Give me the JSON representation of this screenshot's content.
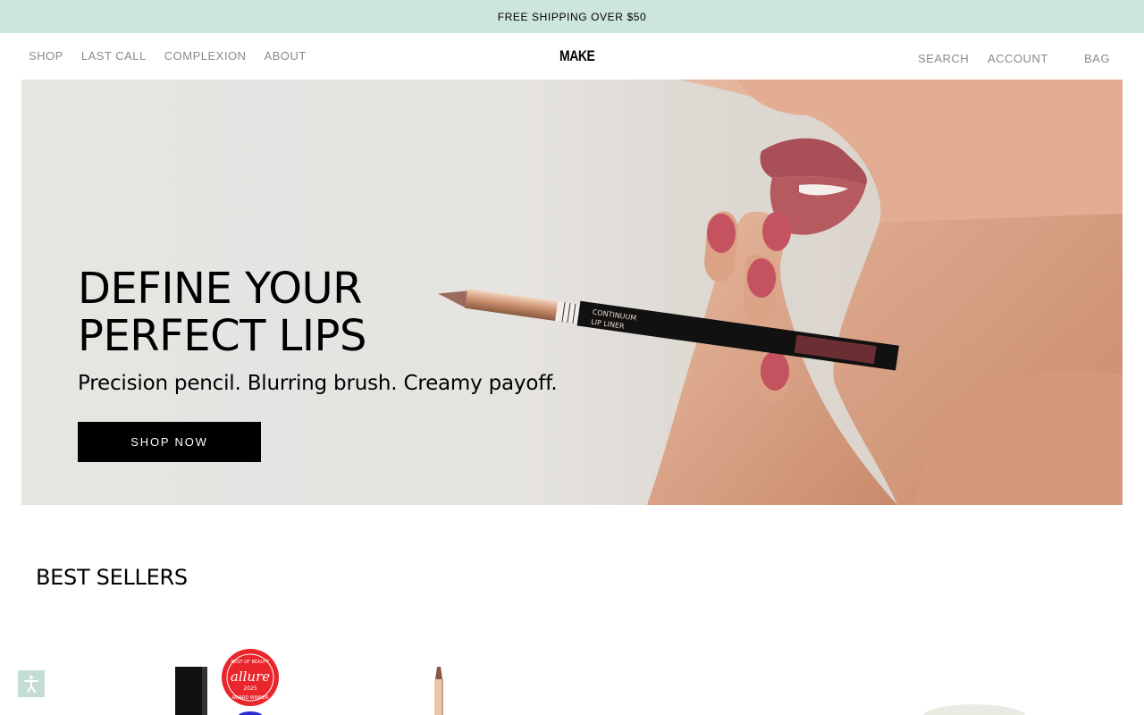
{
  "announcement": "FREE SHIPPING OVER $50",
  "nav": {
    "left": [
      "SHOP",
      "LAST CALL",
      "COMPLEXION",
      "ABOUT"
    ],
    "logo": "MAKE",
    "search": "SEARCH",
    "account": "ACCOUNT",
    "bag": "BAG"
  },
  "hero": {
    "title_line1": "DEFINE YOUR",
    "title_line2": "PERFECT LIPS",
    "subtitle": "Precision pencil. Blurring brush. Creamy payoff.",
    "cta": "SHOP NOW",
    "pencil_print_line1": "CONTINUUM",
    "pencil_print_line2": "LIP LINER"
  },
  "best_sellers": {
    "title": "BEST SELLERS",
    "badge": {
      "brand": "allure",
      "line1": "BEST OF BEAUTY",
      "line2": "AWARD WINNER",
      "year": "2025"
    }
  },
  "colors": {
    "announcement_bg": "#cde6dc",
    "nav_text": "#8a8a8a",
    "cta_bg": "#000000",
    "badge_red": "#e8262b"
  }
}
